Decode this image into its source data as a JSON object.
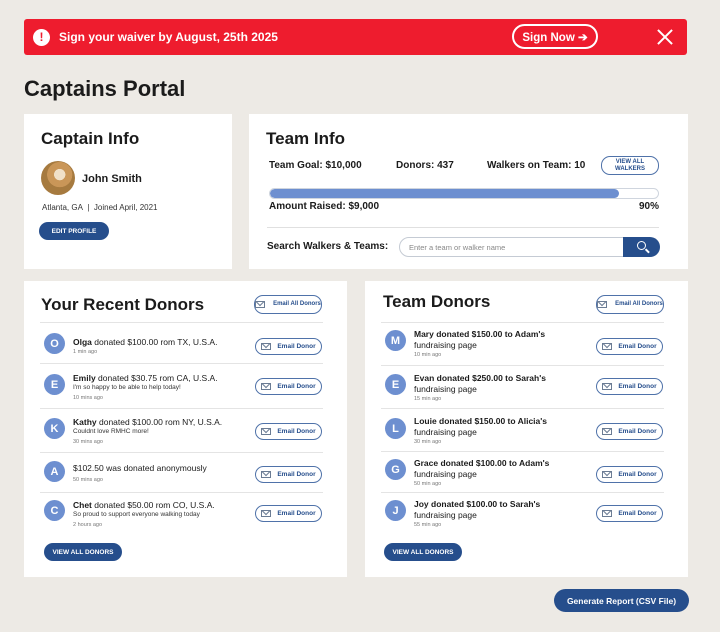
{
  "alert": {
    "icon": "exclamation-icon",
    "text": "Sign your waiver by August, 25th 2025",
    "sign_label": "Sign Now ➔",
    "color": "#ee1c2e"
  },
  "page_title": "Captains Portal",
  "captain": {
    "heading": "Captain Info",
    "name": "John Smith",
    "location": "Atlanta, GA",
    "joined": "Joined April, 2021",
    "edit_label": "EDIT PROFILE"
  },
  "team": {
    "heading": "Team Info",
    "goal": "Team Goal: $10,000",
    "donors": "Donors: 437",
    "walkers": "Walkers on Team: 10",
    "view_walkers_label": "VIEW ALL WALKERS",
    "progress": 0.9,
    "raised": "Amount Raised: $9,000",
    "percent": "90%",
    "search_label": "Search Walkers & Teams:",
    "search_placeholder": "Enter a team or walker name"
  },
  "recent": {
    "heading": "Your Recent Donors",
    "email_all_label": "Email All Donors",
    "email_label": "Email Donor",
    "view_all_label": "VIEW ALL DONORS",
    "rows": [
      {
        "initial": "O",
        "name": "Olga",
        "text": " donated $100.00 rom TX, U.S.A.",
        "note": "",
        "time": "1 min ago"
      },
      {
        "initial": "E",
        "name": "Emily",
        "text": " donated $30.75 rom CA, U.S.A.",
        "note": "I'm so happy to be able to help today!",
        "time": "10 mins ago"
      },
      {
        "initial": "K",
        "name": "Kathy",
        "text": " donated $100.00 rom NY, U.S.A.",
        "note": "Couldnt love RMHC more!",
        "time": "30 mins ago"
      },
      {
        "initial": "A",
        "name": "",
        "text": "$102.50 was donated anonymously",
        "note": "",
        "time": "50 mins ago"
      },
      {
        "initial": "C",
        "name": "Chet",
        "text": " donated $50.00 rom CO, U.S.A.",
        "note": "So proud to support everyone walking today",
        "time": "2 hours ago"
      }
    ]
  },
  "team_donors": {
    "heading": "Team Donors",
    "email_all_label": "Email All Donors",
    "email_label": "Email Donor",
    "view_all_label": "VIEW ALL DONORS",
    "rows": [
      {
        "initial": "M",
        "line1": "Mary donated $150.00 to Adam's",
        "line2": "fundraising page",
        "time": "10 min ago"
      },
      {
        "initial": "E",
        "line1": "Evan donated $250.00 to Sarah's",
        "line2": "fundraising page",
        "time": "15 min ago"
      },
      {
        "initial": "L",
        "line1": "Louie donated $150.00 to Alicia's",
        "line2": "fundraising page",
        "time": "30 min ago"
      },
      {
        "initial": "G",
        "line1": "Grace donated $100.00 to Adam's",
        "line2": "fundraising page",
        "time": "50 min ago"
      },
      {
        "initial": "J",
        "line1": "Joy donated $100.00 to Sarah's",
        "line2": "fundraising page",
        "time": "55 min ago"
      }
    ]
  },
  "report_label": "Generate Report (CSV File)"
}
